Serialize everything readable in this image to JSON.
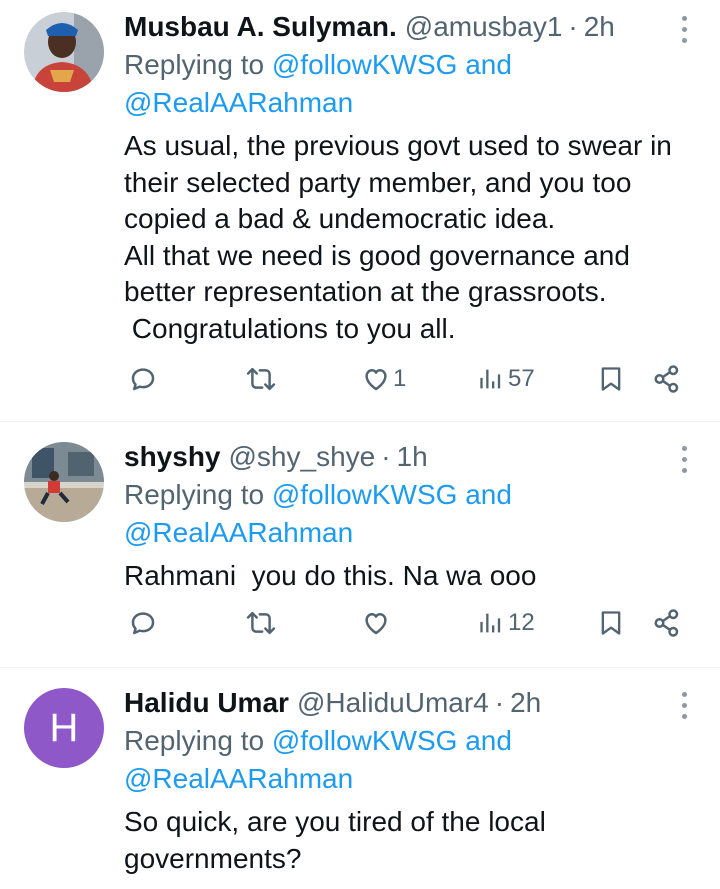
{
  "colors": {
    "link": "#1d9bf0",
    "secondary": "#536471",
    "text": "#0f1419",
    "avatar3_bg": "#8e58c9"
  },
  "tweets": [
    {
      "name": "Musbau A. Sulyman.",
      "handle": "@amusbay1",
      "dot": "·",
      "time": "2h",
      "replying_prefix": "Replying to",
      "mention1": "@followKWSG",
      "and": "and",
      "mention2": "@RealAARahman",
      "body": "As usual, the previous govt used to swear in\ntheir selected party member, and you too\ncopied a bad & undemocratic idea.\nAll that we need is good governance and\nbetter representation at the grassroots.\n Congratulations to you all.",
      "likes": "1",
      "views": "57"
    },
    {
      "name": "shyshy",
      "handle": "@shy_shye",
      "dot": "·",
      "time": "1h",
      "replying_prefix": "Replying to",
      "mention1": "@followKWSG",
      "and": "and",
      "mention2": "@RealAARahman",
      "body": "Rahmani  you do this. Na wa ooo",
      "likes": "",
      "views": "12"
    },
    {
      "name": "Halidu Umar",
      "handle": "@HaliduUmar4",
      "dot": "·",
      "time": "2h",
      "avatar_letter": "H",
      "replying_prefix": "Replying to",
      "mention1": "@followKWSG",
      "and": "and",
      "mention2": "@RealAARahman",
      "body": "So quick, are you tired of the local\ngovernments?"
    }
  ]
}
